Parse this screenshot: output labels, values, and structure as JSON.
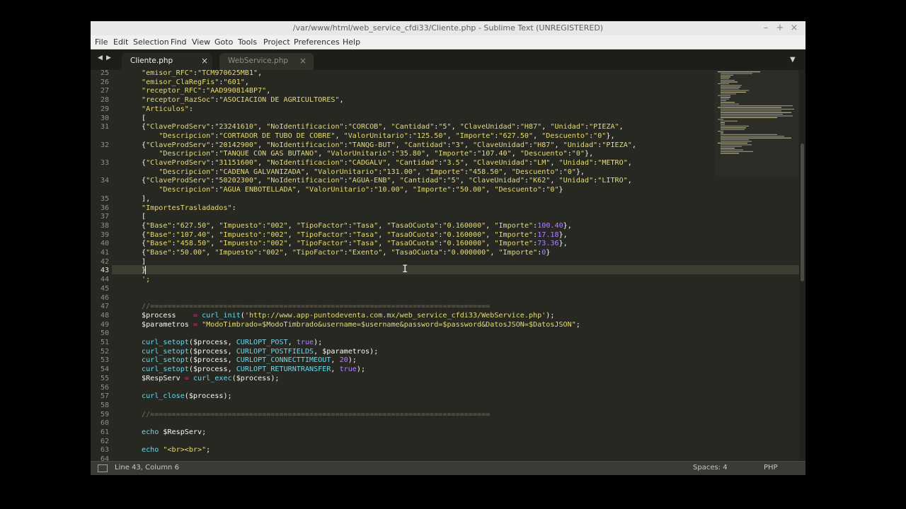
{
  "window": {
    "title": "/var/www/html/web_service_cfdi33/Cliente.php - Sublime Text (UNREGISTERED)",
    "controls": {
      "minimize": "–",
      "maximize": "+",
      "close": "×"
    }
  },
  "menu": [
    "File",
    "Edit",
    "Selection",
    "Find",
    "View",
    "Goto",
    "Tools",
    "Project",
    "Preferences",
    "Help"
  ],
  "tabs": [
    {
      "label": "Cliente.php",
      "active": true
    },
    {
      "label": "WebService.php",
      "active": false
    }
  ],
  "icons": {
    "tab_nav": [
      "nav-back-icon",
      "nav-forward-icon"
    ],
    "tab_close": "close-icon",
    "tab_overflow": "chevron-down-icon",
    "panel_toggle": "panel-switch-icon",
    "mouse": "i-beam-cursor-icon"
  },
  "editor": {
    "current_line": "43",
    "lines": [
      {
        "n": "25",
        "text": "    \"emisor_RFC\":\"TCM970625MB1\","
      },
      {
        "n": "26",
        "text": "    \"emisor_ClaRegFis\":\"601\","
      },
      {
        "n": "27",
        "text": "    \"receptor_RFC\":\"AAD990814BP7\","
      },
      {
        "n": "28",
        "text": "    \"receptor_RazSoc\":\"ASOCIACION DE AGRICULTORES\","
      },
      {
        "n": "29",
        "text": "    \"Articulos\":"
      },
      {
        "n": "30",
        "text": "    ["
      },
      {
        "n": "31",
        "text": "    {\"ClaveProdServ\":\"23241610\", \"NoIdentificacion\":\"CORCOB\", \"Cantidad\":\"5\", \"ClaveUnidad\":\"H87\", \"Unidad\":\"PIEZA\","
      },
      {
        "n": "",
        "text": "        \"Descripcion\":\"CORTADOR DE TUBO DE COBRE\", \"ValorUnitario\":\"125.50\", \"Importe\":\"627.50\", \"Descuento\":\"0\"},"
      },
      {
        "n": "32",
        "text": "    {\"ClaveProdServ\":\"20142900\", \"NoIdentificacion\":\"TANQG-BUT\", \"Cantidad\":\"3\", \"ClaveUnidad\":\"H87\", \"Unidad\":\"PIEZA\","
      },
      {
        "n": "",
        "text": "        \"Descripcion\":\"TANQUE CON GAS BUTANO\", \"ValorUnitario\":\"35.80\", \"Importe\":\"107.40\", \"Descuento\":\"0\"},"
      },
      {
        "n": "33",
        "text": "    {\"ClaveProdServ\":\"31151600\", \"NoIdentificacion\":\"CADGALV\", \"Cantidad\":\"3.5\", \"ClaveUnidad\":\"LM\", \"Unidad\":\"METRO\","
      },
      {
        "n": "",
        "text": "        \"Descripcion\":\"CADENA GALVANIZADA\", \"ValorUnitario\":\"131.00\", \"Importe\":\"458.50\", \"Descuento\":\"0\"},"
      },
      {
        "n": "34",
        "text": "    {\"ClaveProdServ\":\"50202300\", \"NoIdentificacion\":\"AGUA-ENB\", \"Cantidad\":\"5\", \"ClaveUnidad\":\"K62\", \"Unidad\":\"LITRO\","
      },
      {
        "n": "",
        "text": "        \"Descripcion\":\"AGUA ENBOTELLADA\", \"ValorUnitario\":\"10.00\", \"Importe\":\"50.00\", \"Descuento\":\"0\"}"
      },
      {
        "n": "35",
        "text": "    ],"
      },
      {
        "n": "36",
        "text": "    \"ImportesTrasladados\":"
      },
      {
        "n": "37",
        "text": "    ["
      },
      {
        "n": "38",
        "text": "    {\"Base\":\"627.50\", \"Impuesto\":\"002\", \"TipoFactor\":\"Tasa\", \"TasaOCuota\":\"0.160000\", \"Importe\":100.40},"
      },
      {
        "n": "39",
        "text": "    {\"Base\":\"107.40\", \"Impuesto\":\"002\", \"TipoFactor\":\"Tasa\", \"TasaOCuota\":\"0.160000\", \"Importe\":17.18},"
      },
      {
        "n": "40",
        "text": "    {\"Base\":\"458.50\", \"Impuesto\":\"002\", \"TipoFactor\":\"Tasa\", \"TasaOCuota\":\"0.160000\", \"Importe\":73.36},"
      },
      {
        "n": "41",
        "text": "    {\"Base\":\"50.00\", \"Impuesto\":\"002\", \"TipoFactor\":\"Exento\", \"TasaOCuota\":\"0.000000\", \"Importe\":0}"
      },
      {
        "n": "42",
        "text": "    ]"
      },
      {
        "n": "43",
        "text": "    }"
      },
      {
        "n": "44",
        "text": "    ';"
      },
      {
        "n": "45",
        "text": ""
      },
      {
        "n": "46",
        "text": ""
      },
      {
        "n": "47",
        "text": "    //==============================================================================="
      },
      {
        "n": "48",
        "text": "    $process    = curl_init('http://www.app-puntodeventa.com.mx/web_service_cfdi33/WebService.php');"
      },
      {
        "n": "49",
        "text": "    $parametros = \"ModoTimbrado=$ModoTimbrado&username=$username&password=$password&DatosJSON=$DatosJSON\";"
      },
      {
        "n": "50",
        "text": ""
      },
      {
        "n": "51",
        "text": "    curl_setopt($process, CURLOPT_POST, true);"
      },
      {
        "n": "52",
        "text": "    curl_setopt($process, CURLOPT_POSTFIELDS, $parametros);"
      },
      {
        "n": "53",
        "text": "    curl_setopt($process, CURLOPT_CONNECTTIMEOUT, 20);"
      },
      {
        "n": "54",
        "text": "    curl_setopt($process, CURLOPT_RETURNTRANSFER, true);"
      },
      {
        "n": "55",
        "text": "    $RespServ = curl_exec($process);"
      },
      {
        "n": "56",
        "text": ""
      },
      {
        "n": "57",
        "text": "    curl_close($process);"
      },
      {
        "n": "58",
        "text": ""
      },
      {
        "n": "59",
        "text": "    //==============================================================================="
      },
      {
        "n": "60",
        "text": ""
      },
      {
        "n": "61",
        "text": "    echo $RespServ;"
      },
      {
        "n": "62",
        "text": ""
      },
      {
        "n": "63",
        "text": "    echo \"<br><br>\";"
      },
      {
        "n": "64",
        "text": ""
      }
    ]
  },
  "status": {
    "position": "Line 43, Column 6",
    "indent": "Spaces: 4",
    "syntax": "PHP"
  },
  "colors": {
    "editor_bg": "#272822",
    "string": "#e6db74",
    "comment": "#75715e",
    "function": "#66d9ef",
    "number": "#ae81ff",
    "operator": "#f92672",
    "current_line": "#3e3d32"
  }
}
